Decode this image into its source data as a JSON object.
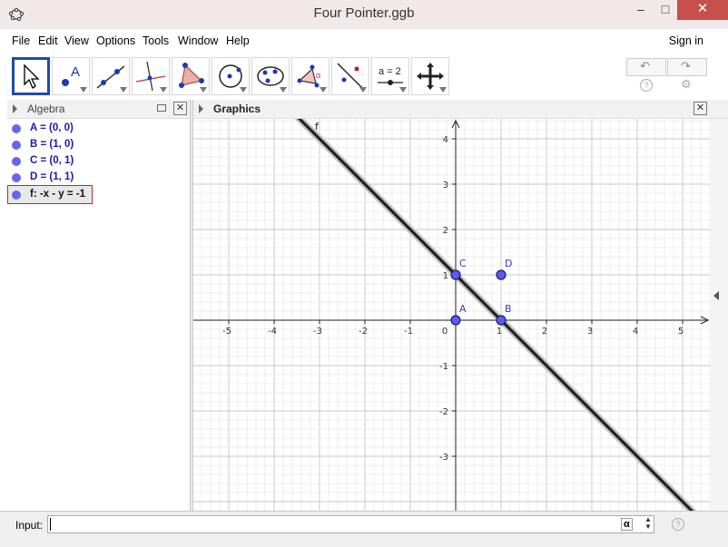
{
  "window": {
    "title": "Four Pointer.ggb",
    "min": "–",
    "max": "□",
    "close": "✕"
  },
  "menu": [
    "File",
    "Edit",
    "View",
    "Options",
    "Tools",
    "Window",
    "Help"
  ],
  "signin": "Sign in",
  "tools": [
    {
      "icon": "move-arrow-icon"
    },
    {
      "icon": "point-icon",
      "label": "A"
    },
    {
      "icon": "line-icon"
    },
    {
      "icon": "perpendicular-line-icon"
    },
    {
      "icon": "polygon-icon"
    },
    {
      "icon": "circle-icon"
    },
    {
      "icon": "conic-icon"
    },
    {
      "icon": "angle-icon",
      "label": "α"
    },
    {
      "icon": "reflect-icon"
    },
    {
      "icon": "slider-icon",
      "label": "a = 2"
    },
    {
      "icon": "move-view-icon"
    }
  ],
  "algebra": {
    "title": "Algebra",
    "items": [
      {
        "label": "A = (0, 0)"
      },
      {
        "label": "B = (1, 0)"
      },
      {
        "label": "C = (0, 1)"
      },
      {
        "label": "D = (1, 1)"
      },
      {
        "label": "f: -x - y = -1",
        "selected": true
      }
    ]
  },
  "graphics": {
    "title": "Graphics",
    "x_ticks": [
      "-5",
      "-4",
      "-3",
      "-2",
      "-1",
      "0",
      "1",
      "2",
      "3",
      "4",
      "5"
    ],
    "y_ticks": [
      "4",
      "3",
      "2",
      "1",
      "-1",
      "-2",
      "-3"
    ],
    "points": [
      {
        "name": "A",
        "x": 0,
        "y": 0
      },
      {
        "name": "B",
        "x": 1,
        "y": 0
      },
      {
        "name": "C",
        "x": 0,
        "y": 1
      },
      {
        "name": "D",
        "x": 1,
        "y": 1
      }
    ],
    "line": {
      "name": "f",
      "equation": "-x - y = -1"
    },
    "point_color": "#5c5cf0"
  },
  "input": {
    "label": "Input:",
    "alpha": "α",
    "help": "?"
  },
  "toolbar_extra": {
    "undo": "↶",
    "redo": "↷",
    "help": "?",
    "gear": "⚙"
  }
}
